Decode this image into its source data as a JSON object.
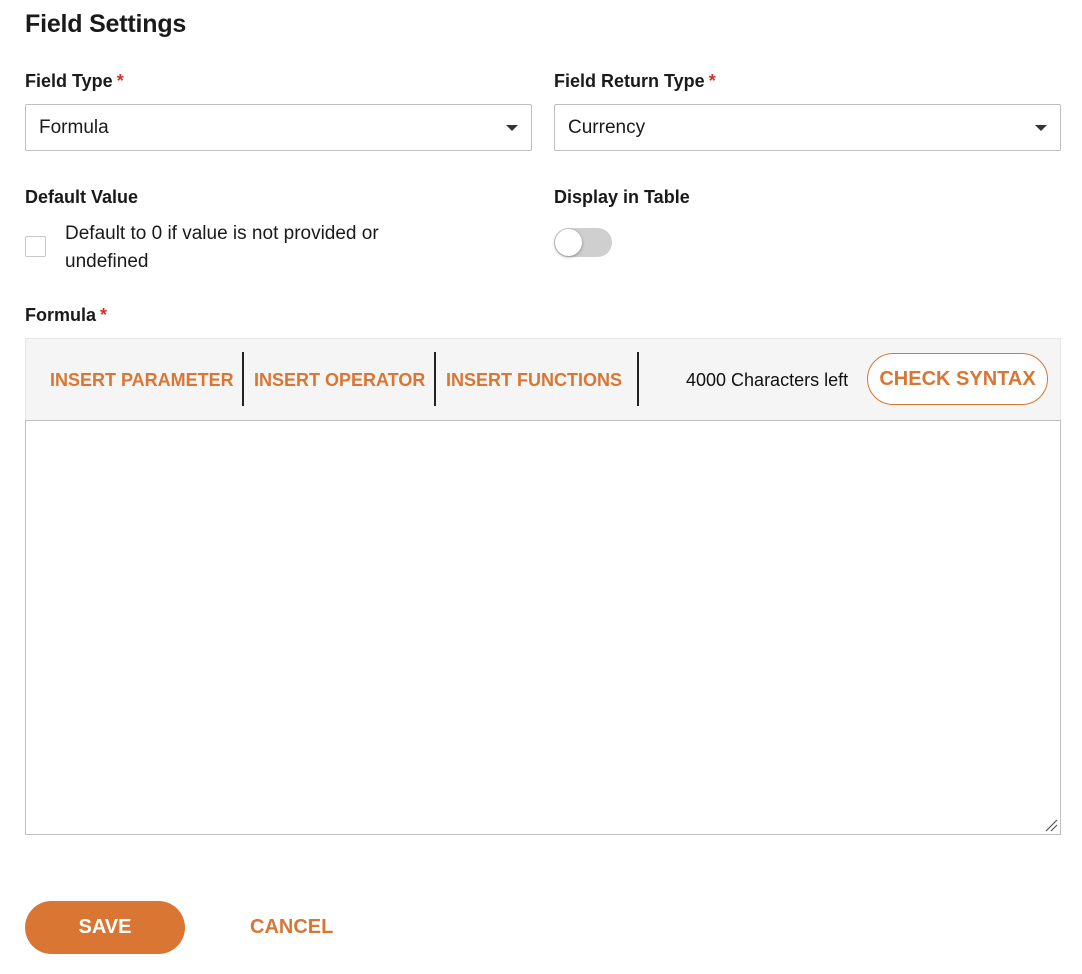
{
  "header": {
    "title": "Field Settings"
  },
  "field_type": {
    "label": "Field Type",
    "required_mark": "*",
    "value": "Formula"
  },
  "field_return_type": {
    "label": "Field Return Type",
    "required_mark": "*",
    "value": "Currency"
  },
  "default_value": {
    "label": "Default Value",
    "checkbox_label": "Default to 0 if value is not provided or undefined",
    "checked": false
  },
  "display_in_table": {
    "label": "Display in Table",
    "enabled": false
  },
  "formula": {
    "label": "Formula",
    "required_mark": "*",
    "toolbar": {
      "insert_parameter": "INSERT PARAMETER",
      "insert_operator": "INSERT OPERATOR",
      "insert_functions": "INSERT FUNCTIONS",
      "chars_left": "4000 Characters left",
      "check_syntax": "CHECK SYNTAX"
    },
    "value": ""
  },
  "actions": {
    "save": "SAVE",
    "cancel": "CANCEL"
  },
  "colors": {
    "accent": "#d97634",
    "required": "#d32f2f",
    "toggle_off": "#cfcfcf"
  },
  "icons": {
    "select_caret": "caret-down-icon",
    "resize": "resize-handle-icon"
  }
}
